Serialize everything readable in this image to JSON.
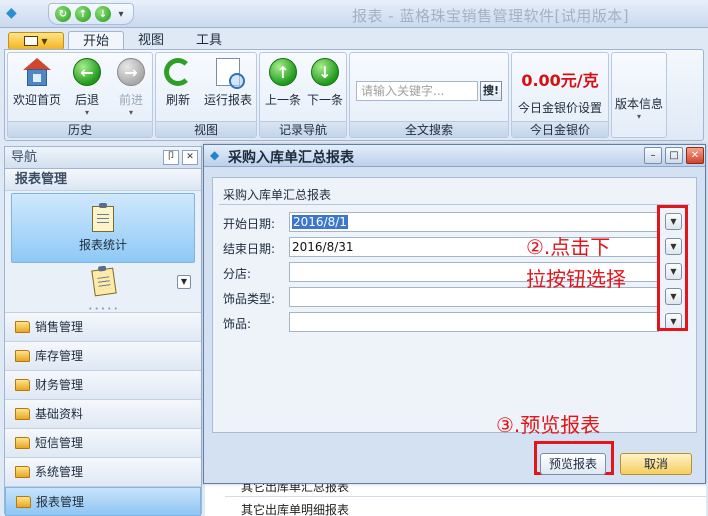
{
  "window": {
    "title": "报表 - 蓝格珠宝销售管理软件[试用版本]"
  },
  "tabs": [
    {
      "label": "开始"
    },
    {
      "label": "视图"
    },
    {
      "label": "工具"
    }
  ],
  "ribbon": {
    "history": {
      "label": "历史",
      "home": "欢迎首页",
      "back": "后退",
      "forward": "前进"
    },
    "view": {
      "label": "视图",
      "refresh": "刷新",
      "run_report": "运行报表"
    },
    "record_nav": {
      "label": "记录导航",
      "prev": "上一条",
      "next": "下一条"
    },
    "fulltext": {
      "label": "全文搜索",
      "placeholder": "请输入关键字...",
      "search_btn": "搜!"
    },
    "gold": {
      "label": "今日金银价",
      "price": "0.00元/克",
      "setting": "今日金银价设置"
    },
    "version": {
      "label": "版本信息"
    }
  },
  "nav": {
    "title": "导航",
    "pin": "卩",
    "close": "✕",
    "section": "报表管理",
    "tile_label": "报表统计",
    "items": [
      {
        "label": "销售管理"
      },
      {
        "label": "库存管理"
      },
      {
        "label": "财务管理"
      },
      {
        "label": "基础资料"
      },
      {
        "label": "短信管理"
      },
      {
        "label": "系统管理"
      },
      {
        "label": "报表管理"
      }
    ]
  },
  "background_list": {
    "row1": "其它出库单汇总报表",
    "row2": "其它出库单明细报表"
  },
  "dialog": {
    "title": "采购入库单汇总报表",
    "group_caption": "采购入库单汇总报表",
    "fields": [
      {
        "label": "开始日期:",
        "value": "2016/8/1"
      },
      {
        "label": "结束日期:",
        "value": "2016/8/31"
      },
      {
        "label": "分店:",
        "value": ""
      },
      {
        "label": "饰品类型:",
        "value": ""
      },
      {
        "label": "饰品:",
        "value": ""
      }
    ],
    "preview_btn": "预览报表",
    "cancel_btn": "取消"
  },
  "annotations": {
    "step2_line1": "②.点击下",
    "step2_line2": "拉按钮选择",
    "step3": "③.预览报表"
  },
  "colors": {
    "annotation": "#e3151b",
    "gold_price": "#d61010",
    "accent": "#3b77cf"
  }
}
